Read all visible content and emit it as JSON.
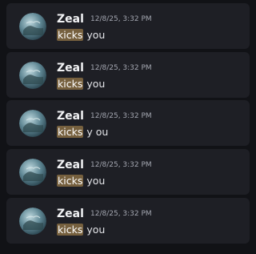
{
  "colors": {
    "page_background": "#111216",
    "message_background": "#1e1f25",
    "username": "#f2f3f5",
    "timestamp": "#a3a6b0",
    "text": "#e4e5e9",
    "highlight": "#76603e"
  },
  "messages": [
    {
      "avatar_icon": "earth-avatar-icon",
      "username": "Zeal",
      "timestamp": "12/8/25, 3:32 PM",
      "highlight": "kicks",
      "rest": " you"
    },
    {
      "avatar_icon": "earth-avatar-icon",
      "username": "Zeal",
      "timestamp": "12/8/25, 3:32 PM",
      "highlight": "kicks",
      "rest": " you"
    },
    {
      "avatar_icon": "earth-avatar-icon",
      "username": "Zeal",
      "timestamp": "12/8/25, 3:32 PM",
      "highlight": "kicks",
      "rest": " y ou"
    },
    {
      "avatar_icon": "earth-avatar-icon",
      "username": "Zeal",
      "timestamp": "12/8/25, 3:32 PM",
      "highlight": "kicks",
      "rest": " you"
    },
    {
      "avatar_icon": "earth-avatar-icon",
      "username": "Zeal",
      "timestamp": "12/8/25, 3:32 PM",
      "highlight": "kicks",
      "rest": " you"
    }
  ]
}
